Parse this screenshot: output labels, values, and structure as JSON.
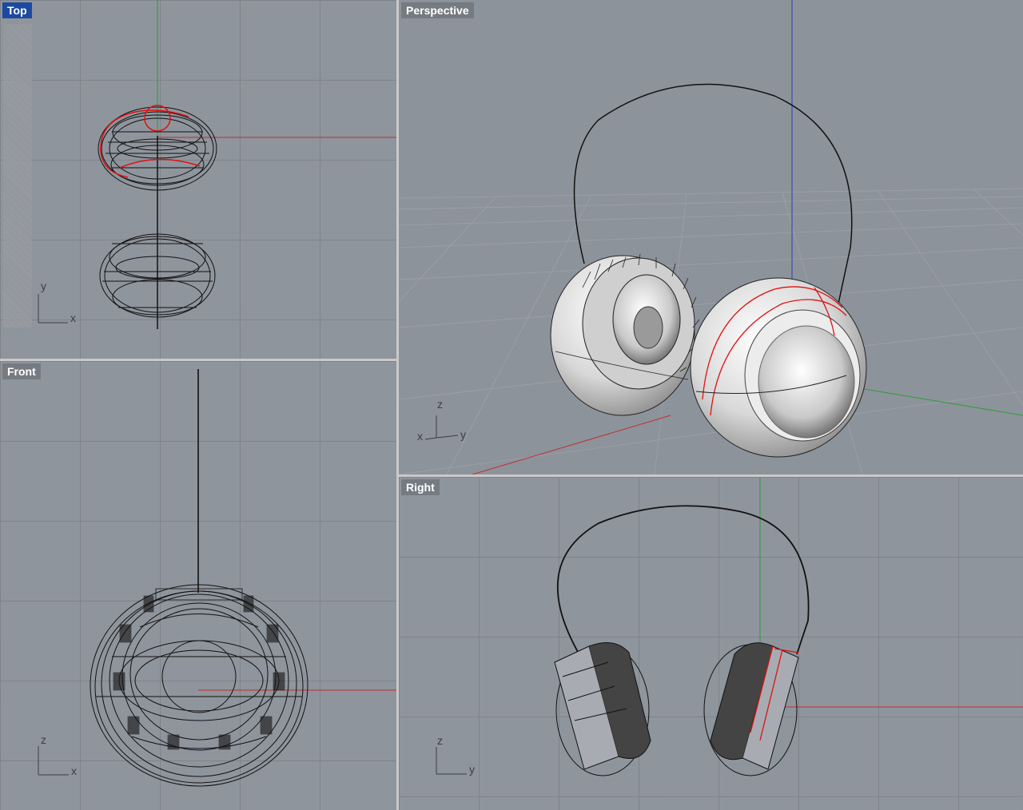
{
  "viewports": {
    "top": {
      "label": "Top",
      "axes": [
        "y",
        "x"
      ],
      "active": true
    },
    "front": {
      "label": "Front",
      "axes": [
        "z",
        "x"
      ]
    },
    "perspective": {
      "label": "Perspective",
      "axes": [
        "z",
        "x",
        "y"
      ]
    },
    "right": {
      "label": "Right",
      "axes": [
        "z",
        "y"
      ]
    }
  },
  "colors": {
    "viewport_bg": "#8f959d",
    "active_label": "#1c4aa0",
    "x_axis": "#c0302f",
    "y_axis": "#2e9a3a",
    "z_axis": "#2c3cb8",
    "selection": "#e01010"
  }
}
